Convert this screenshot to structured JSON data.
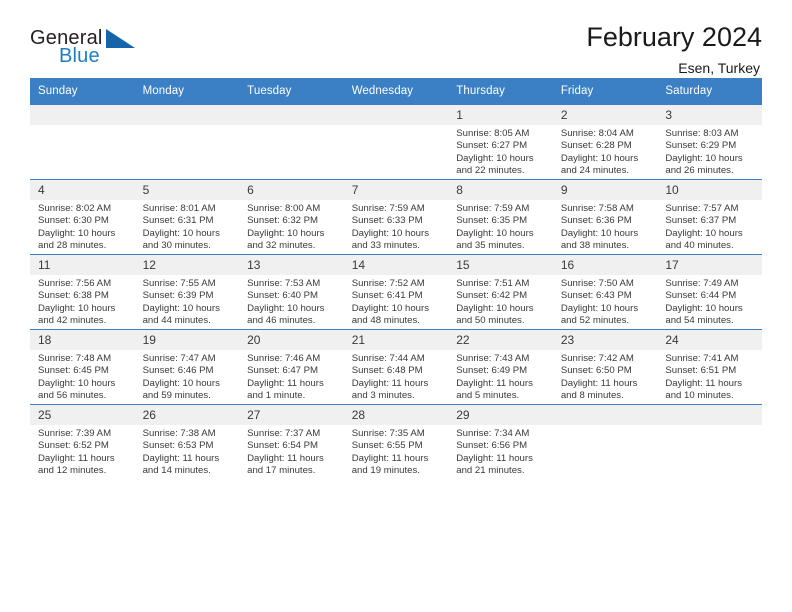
{
  "brand": {
    "word_one": "General",
    "word_two": "Blue"
  },
  "header": {
    "title": "February 2024",
    "location": "Esen, Turkey"
  },
  "calendar": {
    "weekdays": [
      "Sunday",
      "Monday",
      "Tuesday",
      "Wednesday",
      "Thursday",
      "Friday",
      "Saturday"
    ],
    "accent_color": "#3b7fc4",
    "daynum_band_color": "#f0f0f0",
    "weeks": [
      [
        {
          "day": "",
          "empty": true,
          "sunrise": "",
          "sunset": "",
          "daylight_1": "",
          "daylight_2": ""
        },
        {
          "day": "",
          "empty": true,
          "sunrise": "",
          "sunset": "",
          "daylight_1": "",
          "daylight_2": ""
        },
        {
          "day": "",
          "empty": true,
          "sunrise": "",
          "sunset": "",
          "daylight_1": "",
          "daylight_2": ""
        },
        {
          "day": "",
          "empty": true,
          "sunrise": "",
          "sunset": "",
          "daylight_1": "",
          "daylight_2": ""
        },
        {
          "day": "1",
          "empty": false,
          "sunrise": "Sunrise: 8:05 AM",
          "sunset": "Sunset: 6:27 PM",
          "daylight_1": "Daylight: 10 hours",
          "daylight_2": "and 22 minutes."
        },
        {
          "day": "2",
          "empty": false,
          "sunrise": "Sunrise: 8:04 AM",
          "sunset": "Sunset: 6:28 PM",
          "daylight_1": "Daylight: 10 hours",
          "daylight_2": "and 24 minutes."
        },
        {
          "day": "3",
          "empty": false,
          "sunrise": "Sunrise: 8:03 AM",
          "sunset": "Sunset: 6:29 PM",
          "daylight_1": "Daylight: 10 hours",
          "daylight_2": "and 26 minutes."
        }
      ],
      [
        {
          "day": "4",
          "empty": false,
          "sunrise": "Sunrise: 8:02 AM",
          "sunset": "Sunset: 6:30 PM",
          "daylight_1": "Daylight: 10 hours",
          "daylight_2": "and 28 minutes."
        },
        {
          "day": "5",
          "empty": false,
          "sunrise": "Sunrise: 8:01 AM",
          "sunset": "Sunset: 6:31 PM",
          "daylight_1": "Daylight: 10 hours",
          "daylight_2": "and 30 minutes."
        },
        {
          "day": "6",
          "empty": false,
          "sunrise": "Sunrise: 8:00 AM",
          "sunset": "Sunset: 6:32 PM",
          "daylight_1": "Daylight: 10 hours",
          "daylight_2": "and 32 minutes."
        },
        {
          "day": "7",
          "empty": false,
          "sunrise": "Sunrise: 7:59 AM",
          "sunset": "Sunset: 6:33 PM",
          "daylight_1": "Daylight: 10 hours",
          "daylight_2": "and 33 minutes."
        },
        {
          "day": "8",
          "empty": false,
          "sunrise": "Sunrise: 7:59 AM",
          "sunset": "Sunset: 6:35 PM",
          "daylight_1": "Daylight: 10 hours",
          "daylight_2": "and 35 minutes."
        },
        {
          "day": "9",
          "empty": false,
          "sunrise": "Sunrise: 7:58 AM",
          "sunset": "Sunset: 6:36 PM",
          "daylight_1": "Daylight: 10 hours",
          "daylight_2": "and 38 minutes."
        },
        {
          "day": "10",
          "empty": false,
          "sunrise": "Sunrise: 7:57 AM",
          "sunset": "Sunset: 6:37 PM",
          "daylight_1": "Daylight: 10 hours",
          "daylight_2": "and 40 minutes."
        }
      ],
      [
        {
          "day": "11",
          "empty": false,
          "sunrise": "Sunrise: 7:56 AM",
          "sunset": "Sunset: 6:38 PM",
          "daylight_1": "Daylight: 10 hours",
          "daylight_2": "and 42 minutes."
        },
        {
          "day": "12",
          "empty": false,
          "sunrise": "Sunrise: 7:55 AM",
          "sunset": "Sunset: 6:39 PM",
          "daylight_1": "Daylight: 10 hours",
          "daylight_2": "and 44 minutes."
        },
        {
          "day": "13",
          "empty": false,
          "sunrise": "Sunrise: 7:53 AM",
          "sunset": "Sunset: 6:40 PM",
          "daylight_1": "Daylight: 10 hours",
          "daylight_2": "and 46 minutes."
        },
        {
          "day": "14",
          "empty": false,
          "sunrise": "Sunrise: 7:52 AM",
          "sunset": "Sunset: 6:41 PM",
          "daylight_1": "Daylight: 10 hours",
          "daylight_2": "and 48 minutes."
        },
        {
          "day": "15",
          "empty": false,
          "sunrise": "Sunrise: 7:51 AM",
          "sunset": "Sunset: 6:42 PM",
          "daylight_1": "Daylight: 10 hours",
          "daylight_2": "and 50 minutes."
        },
        {
          "day": "16",
          "empty": false,
          "sunrise": "Sunrise: 7:50 AM",
          "sunset": "Sunset: 6:43 PM",
          "daylight_1": "Daylight: 10 hours",
          "daylight_2": "and 52 minutes."
        },
        {
          "day": "17",
          "empty": false,
          "sunrise": "Sunrise: 7:49 AM",
          "sunset": "Sunset: 6:44 PM",
          "daylight_1": "Daylight: 10 hours",
          "daylight_2": "and 54 minutes."
        }
      ],
      [
        {
          "day": "18",
          "empty": false,
          "sunrise": "Sunrise: 7:48 AM",
          "sunset": "Sunset: 6:45 PM",
          "daylight_1": "Daylight: 10 hours",
          "daylight_2": "and 56 minutes."
        },
        {
          "day": "19",
          "empty": false,
          "sunrise": "Sunrise: 7:47 AM",
          "sunset": "Sunset: 6:46 PM",
          "daylight_1": "Daylight: 10 hours",
          "daylight_2": "and 59 minutes."
        },
        {
          "day": "20",
          "empty": false,
          "sunrise": "Sunrise: 7:46 AM",
          "sunset": "Sunset: 6:47 PM",
          "daylight_1": "Daylight: 11 hours",
          "daylight_2": "and 1 minute."
        },
        {
          "day": "21",
          "empty": false,
          "sunrise": "Sunrise: 7:44 AM",
          "sunset": "Sunset: 6:48 PM",
          "daylight_1": "Daylight: 11 hours",
          "daylight_2": "and 3 minutes."
        },
        {
          "day": "22",
          "empty": false,
          "sunrise": "Sunrise: 7:43 AM",
          "sunset": "Sunset: 6:49 PM",
          "daylight_1": "Daylight: 11 hours",
          "daylight_2": "and 5 minutes."
        },
        {
          "day": "23",
          "empty": false,
          "sunrise": "Sunrise: 7:42 AM",
          "sunset": "Sunset: 6:50 PM",
          "daylight_1": "Daylight: 11 hours",
          "daylight_2": "and 8 minutes."
        },
        {
          "day": "24",
          "empty": false,
          "sunrise": "Sunrise: 7:41 AM",
          "sunset": "Sunset: 6:51 PM",
          "daylight_1": "Daylight: 11 hours",
          "daylight_2": "and 10 minutes."
        }
      ],
      [
        {
          "day": "25",
          "empty": false,
          "sunrise": "Sunrise: 7:39 AM",
          "sunset": "Sunset: 6:52 PM",
          "daylight_1": "Daylight: 11 hours",
          "daylight_2": "and 12 minutes."
        },
        {
          "day": "26",
          "empty": false,
          "sunrise": "Sunrise: 7:38 AM",
          "sunset": "Sunset: 6:53 PM",
          "daylight_1": "Daylight: 11 hours",
          "daylight_2": "and 14 minutes."
        },
        {
          "day": "27",
          "empty": false,
          "sunrise": "Sunrise: 7:37 AM",
          "sunset": "Sunset: 6:54 PM",
          "daylight_1": "Daylight: 11 hours",
          "daylight_2": "and 17 minutes."
        },
        {
          "day": "28",
          "empty": false,
          "sunrise": "Sunrise: 7:35 AM",
          "sunset": "Sunset: 6:55 PM",
          "daylight_1": "Daylight: 11 hours",
          "daylight_2": "and 19 minutes."
        },
        {
          "day": "29",
          "empty": false,
          "sunrise": "Sunrise: 7:34 AM",
          "sunset": "Sunset: 6:56 PM",
          "daylight_1": "Daylight: 11 hours",
          "daylight_2": "and 21 minutes."
        },
        {
          "day": "",
          "empty": true,
          "sunrise": "",
          "sunset": "",
          "daylight_1": "",
          "daylight_2": ""
        },
        {
          "day": "",
          "empty": true,
          "sunrise": "",
          "sunset": "",
          "daylight_1": "",
          "daylight_2": ""
        }
      ]
    ]
  }
}
